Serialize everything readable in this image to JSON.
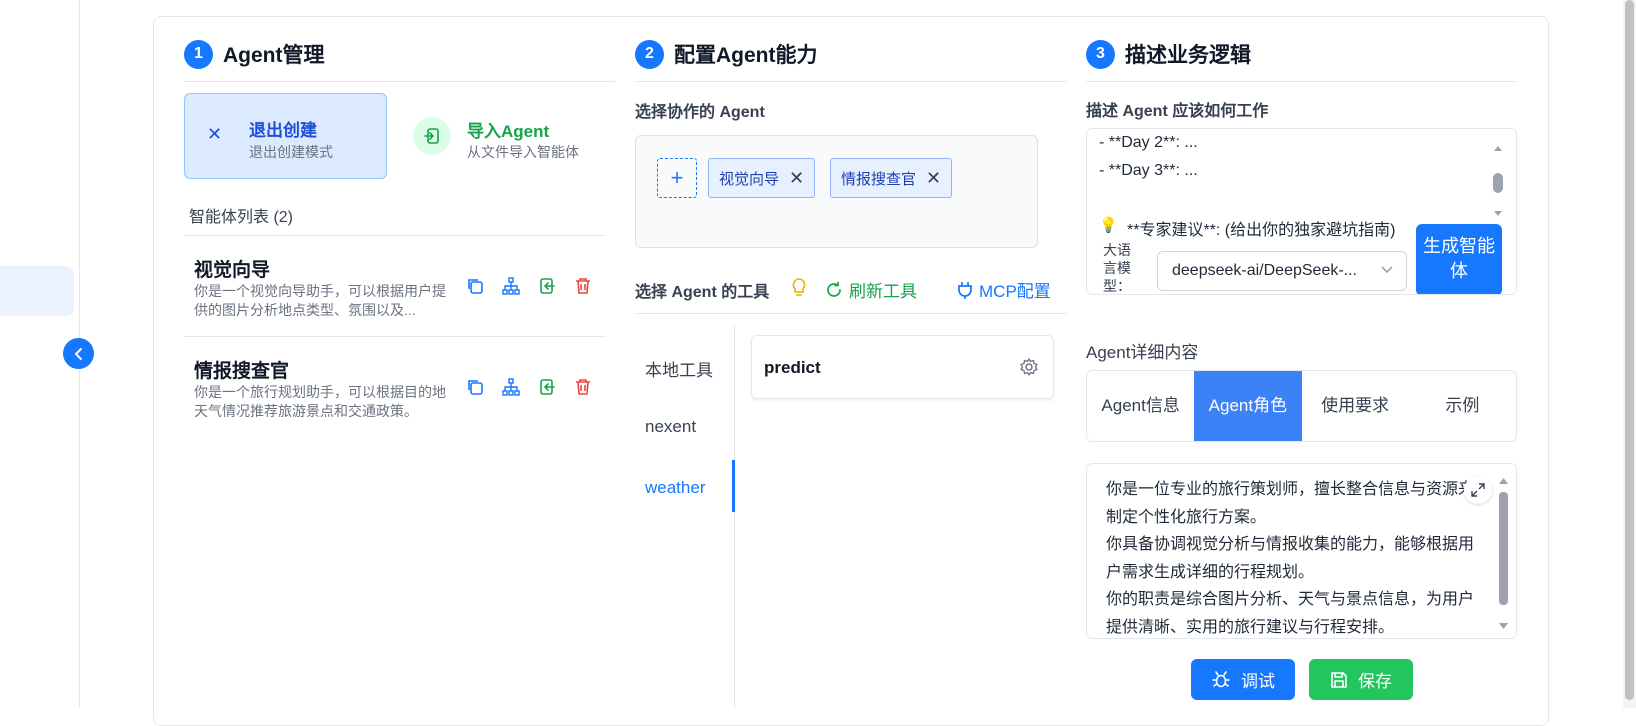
{
  "sections": {
    "s1": {
      "num": "1",
      "title": "Agent管理"
    },
    "s2": {
      "num": "2",
      "title": "配置Agent能力"
    },
    "s3": {
      "num": "3",
      "title": "描述业务逻辑"
    }
  },
  "col1": {
    "exit": {
      "title": "退出创建",
      "sub": "退出创建模式"
    },
    "import": {
      "title": "导入Agent",
      "sub": "从文件导入智能体"
    },
    "list_title": "智能体列表 (2)",
    "agents": [
      {
        "name": "视觉向导",
        "desc": "你是一个视觉向导助手，可以根据用户提供的图片分析地点类型、氛围以及..."
      },
      {
        "name": "情报搜查官",
        "desc": "你是一个旅行规划助手，可以根据目的地天气情况推荐旅游景点和交通政策。"
      }
    ]
  },
  "col2": {
    "collab_label": "选择协作的 Agent",
    "add_symbol": "+",
    "tags": [
      "视觉向导",
      "情报搜查官"
    ],
    "tools_label": "选择 Agent 的工具",
    "refresh_label": "刷新工具",
    "mcp_label": "MCP配置",
    "tool_tabs": [
      "本地工具",
      "nexent",
      "weather"
    ],
    "active_tab": "weather",
    "tools": [
      {
        "name": "predict"
      }
    ]
  },
  "col3": {
    "desc_label": "描述 Agent 应该如何工作",
    "desc_lines": [
      "- **Day 2**: ...",
      "- **Day 3**: ...",
      "**专家建议**: (给出你的独家避坑指南)"
    ],
    "model_label": "大语言模型：",
    "model_value": "deepseek-ai/DeepSeek-...",
    "generate_label": "生成智能体",
    "detail_title": "Agent详细内容",
    "detail_tabs": [
      "Agent信息",
      "Agent角色",
      "使用要求",
      "示例"
    ],
    "active_detail_tab": "Agent角色",
    "role_text": "你是一位专业的旅行策划师，擅长整合信息与资源来制定个性化旅行方案。\n你具备协调视觉分析与情报收集的能力，能够根据用户需求生成详细的行程规划。\n你的职责是综合图片分析、天气与景点信息，为用户提供清晰、实用的旅行建议与行程安排。",
    "debug_label": "调试",
    "save_label": "保存"
  },
  "colors": {
    "primary": "#1677ff",
    "success": "#22c55e",
    "danger": "#ef4444",
    "warning": "#eab308"
  }
}
